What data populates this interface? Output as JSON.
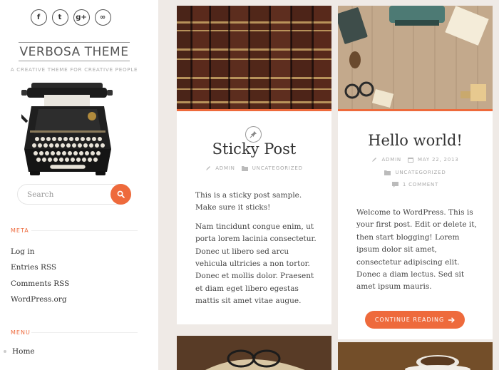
{
  "site": {
    "title": "VERBOSA THEME",
    "tagline": "A CREATIVE THEME FOR CREATIVE PEOPLE"
  },
  "social": [
    {
      "icon": "facebook-icon",
      "glyph": "f"
    },
    {
      "icon": "twitter-icon",
      "glyph": "t"
    },
    {
      "icon": "google-plus-icon",
      "glyph": "g+"
    },
    {
      "icon": "link-icon",
      "glyph": "∞"
    }
  ],
  "search": {
    "placeholder": "Search"
  },
  "meta_widget": {
    "title": "META",
    "items": [
      "Log in",
      "Entries RSS",
      "Comments RSS",
      "WordPress.org"
    ]
  },
  "menu_widget": {
    "title": "MENU",
    "items": [
      "Home"
    ]
  },
  "posts": [
    {
      "title": "Sticky Post",
      "author": "ADMIN",
      "category": "UNCATEGORIZED",
      "paragraphs": [
        "This is a sticky post sample. Make sure it sticks!",
        "Nam tincidunt congue enim, ut porta lorem lacinia consectetur. Donec ut libero sed arcu vehicula ultricies a non tortor.  Donec et mollis dolor. Praesent et diam eget libero egestas mattis sit amet vitae augue."
      ]
    },
    {
      "title": "Hello world!",
      "author": "ADMIN",
      "date": "MAY 22, 2013",
      "category": "UNCATEGORIZED",
      "comments": "1 COMMENT",
      "paragraphs": [
        "Welcome to WordPress. This is your first post. Edit or delete it, then start blogging! Lorem ipsum dolor sit amet, consectetur adipiscing elit. Donec a diam lectus. Sed sit amet ipsum mauris."
      ],
      "button": "CONTINUE READING"
    }
  ],
  "colors": {
    "accent": "#ee6a3c",
    "background": "#efeae6"
  }
}
